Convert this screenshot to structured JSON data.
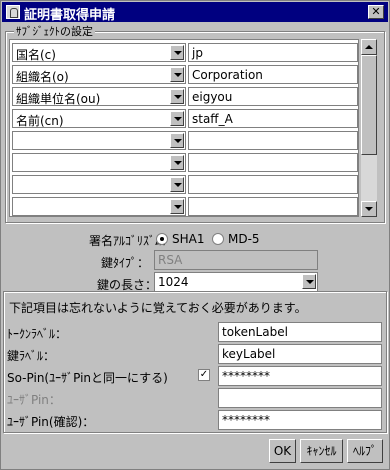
{
  "window": {
    "title": "証明書取得申請",
    "close_label": "✕"
  },
  "subject": {
    "group_label": "ｻﾌﾞｼﾞｪｸﾄの設定",
    "rows": [
      {
        "key": "国名(c)",
        "value": "jp"
      },
      {
        "key": "組織名(o)",
        "value": "Corporation"
      },
      {
        "key": "組織単位名(ou)",
        "value": "eigyou"
      },
      {
        "key": "名前(cn)",
        "value": "staff_A"
      },
      {
        "key": "",
        "value": ""
      },
      {
        "key": "",
        "value": ""
      },
      {
        "key": "",
        "value": ""
      },
      {
        "key": "",
        "value": ""
      }
    ]
  },
  "algorithm": {
    "label": "署名ｱﾙｺﾞﾘｽﾞﾑ：",
    "options": [
      "SHA1",
      "MD-5"
    ],
    "selected": "SHA1"
  },
  "key_type": {
    "label": "鍵ﾀｲﾌﾟ：",
    "value": "RSA"
  },
  "key_length": {
    "label": "鍵の長さ：",
    "value": "1024"
  },
  "notice": "下記項目は忘れないように覚えておく必要があります。",
  "token_label": {
    "label": "ﾄｰｸﾝﾗﾍﾞﾙ：",
    "value": "tokenLabel"
  },
  "key_label": {
    "label": "鍵ﾗﾍﾞﾙ：",
    "value": "keyLabel"
  },
  "so_pin": {
    "label": "So-Pin(ﾕｰｻﾞPinと同一にする)",
    "checked": true,
    "check_mark": "✓",
    "value": "********"
  },
  "user_pin": {
    "label": "ﾕｰｻﾞPin：",
    "value": ""
  },
  "user_pin_confirm": {
    "label": "ﾕｰｻﾞPin(確認)：",
    "value": "********"
  },
  "buttons": {
    "ok": "OK",
    "cancel": "ｷｬﾝｾﾙ",
    "help": "ﾍﾙﾌﾟ"
  }
}
